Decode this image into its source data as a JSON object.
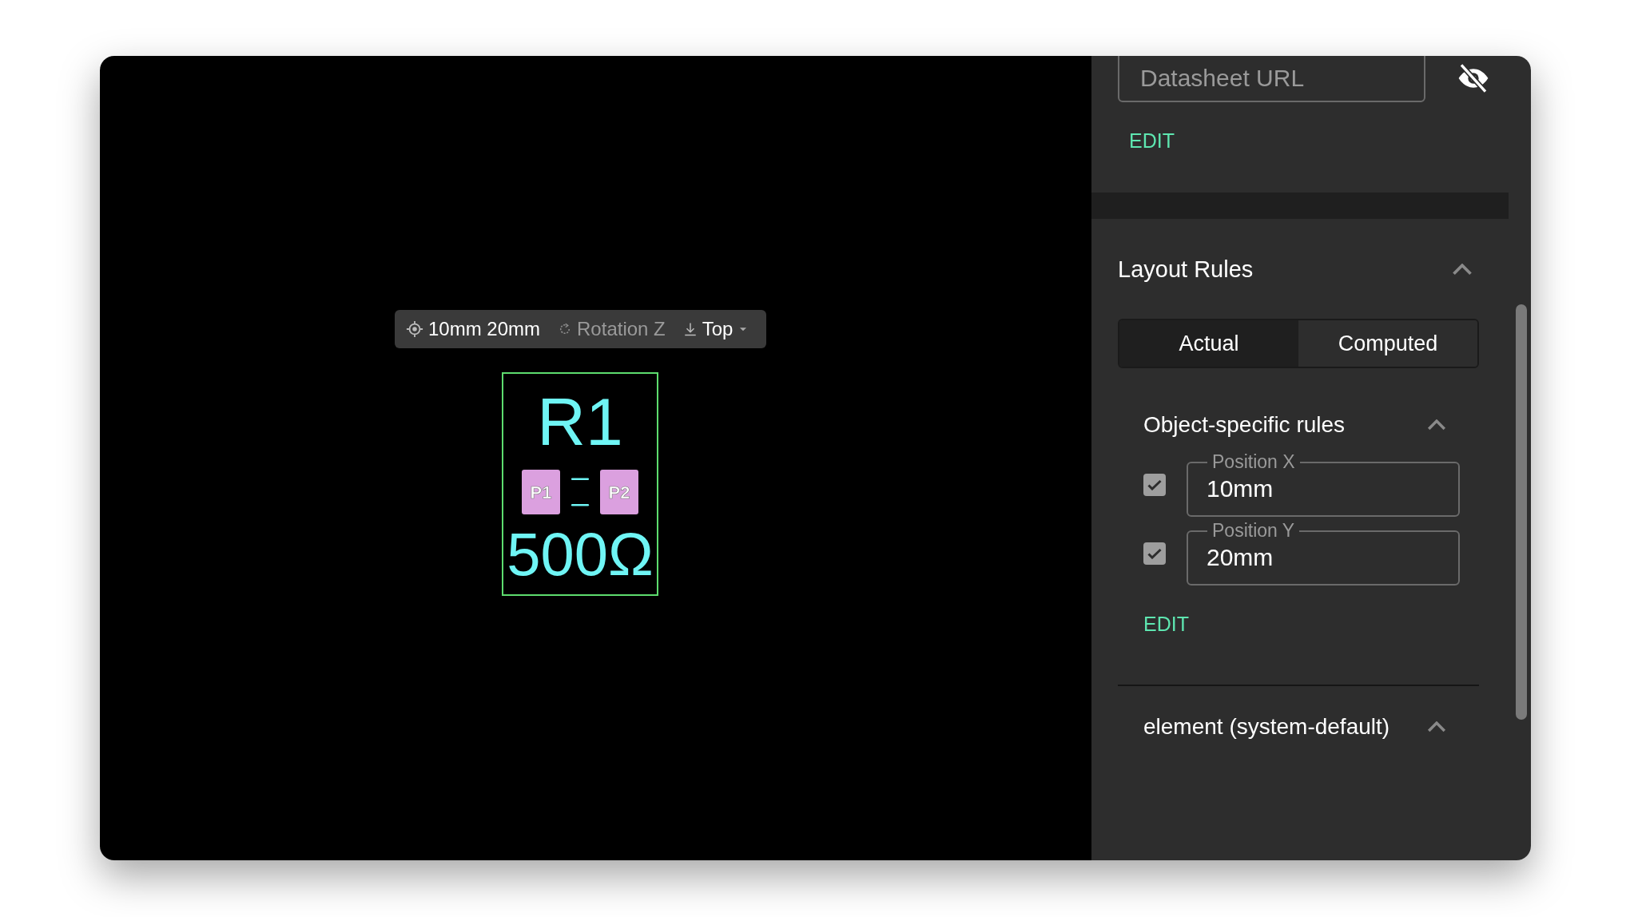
{
  "canvas": {
    "toolbar": {
      "position": "10mm 20mm",
      "rotation": {
        "label": "Rotation Z",
        "disabled": true
      },
      "layer": "Top"
    },
    "component": {
      "designator": "R1",
      "value": "500Ω",
      "pads": [
        "P1",
        "P2"
      ]
    }
  },
  "panel": {
    "datasheet": {
      "placeholder": "Datasheet URL",
      "hidden": true
    },
    "edit_link": "EDIT",
    "layout_rules": {
      "title": "Layout Rules",
      "expanded": true,
      "tabs": [
        {
          "label": "Actual",
          "selected": true
        },
        {
          "label": "Computed",
          "selected": false
        }
      ],
      "groups": [
        {
          "title": "Object-specific rules",
          "expanded": true,
          "rules": [
            {
              "label": "Position X",
              "value": "10mm",
              "checked": true
            },
            {
              "label": "Position Y",
              "value": "20mm",
              "checked": true
            }
          ],
          "edit_link": "EDIT"
        },
        {
          "title": "element (system-default)",
          "expanded": true
        }
      ]
    }
  }
}
